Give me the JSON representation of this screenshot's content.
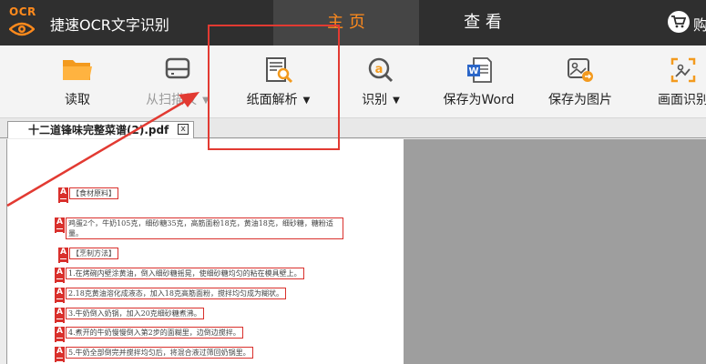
{
  "app": {
    "logo_text": "OCR",
    "title": "捷速OCR文字识别"
  },
  "nav": {
    "tabs": [
      {
        "label": "主 页",
        "active": true
      },
      {
        "label": "查 看",
        "active": false
      }
    ],
    "cart_label": "购"
  },
  "toolbar": {
    "items": [
      {
        "label": "读取",
        "icon": "folder-icon",
        "has_dropdown": false,
        "disabled": false
      },
      {
        "label": "从扫描仪",
        "icon": "scanner-icon",
        "has_dropdown": true,
        "disabled": true
      },
      {
        "label": "纸面解析",
        "icon": "page-analysis-icon",
        "has_dropdown": true,
        "disabled": false
      },
      {
        "label": "识别",
        "icon": "recognize-icon",
        "has_dropdown": true,
        "disabled": false
      },
      {
        "label": "保存为Word",
        "icon": "word-icon",
        "has_dropdown": false,
        "disabled": false
      },
      {
        "label": "保存为图片",
        "icon": "save-image-icon",
        "has_dropdown": false,
        "disabled": false
      },
      {
        "label": "画面识别",
        "icon": "screen-capture-icon",
        "has_dropdown": false,
        "disabled": false
      }
    ]
  },
  "document": {
    "tab_name": "十二道锋味完整菜谱(2).pdf",
    "close_glyph": "x",
    "marker_letter": "A",
    "lines": [
      "【食材原料】",
      "鸡蛋2个，牛奶105克，细砂糖35克，高筋面粉18克，黄油18克，细砂糖，糖粉适量。",
      "【烹制方法】",
      "1.在烤碗内壁涂黄油，倒入细砂糖摇晃，使细砂糖均匀的粘在模具壁上。",
      "2.18克黄油溶化成液态，加入18克高筋面粉，搅拌均匀成为糊状。",
      "3.牛奶倒入奶锅，加入20克细砂糖煮沸。",
      "4.煮开的牛奶慢慢倒入第2步的面糊里，边倒边搅拌。",
      "5.牛奶全部倒完并搅拌均匀后，将混合液过筛回奶锅里。"
    ]
  },
  "colors": {
    "accent": "#ff8a1c",
    "titlebar": "#2f2f2f",
    "annotation_red": "#e23a32"
  }
}
